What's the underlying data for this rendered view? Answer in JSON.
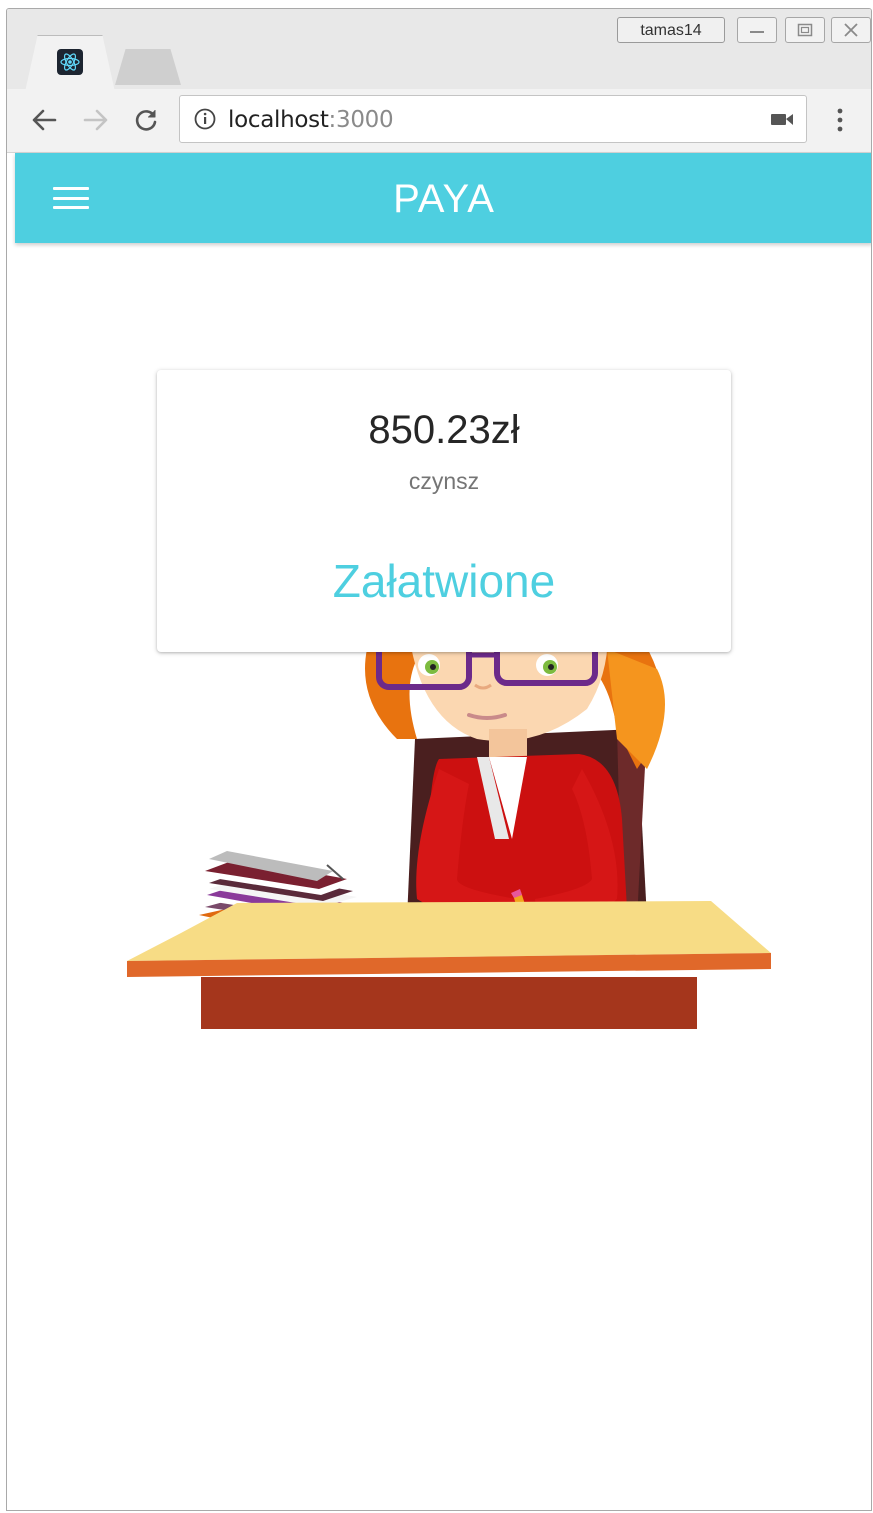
{
  "browser": {
    "user_badge": "tamas14",
    "address": {
      "host": "localhost",
      "port": ":3000"
    },
    "icons": {
      "favicon": "react-icon",
      "back": "back-arrow-icon",
      "forward": "forward-arrow-icon",
      "reload": "reload-icon",
      "info": "info-icon",
      "camera": "camera-icon",
      "menu": "more-vert-icon"
    }
  },
  "app": {
    "title": "PAYA",
    "accent_color": "#4ecfe0",
    "menu_icon": "hamburger-menu-icon"
  },
  "card": {
    "amount": "850.23zł",
    "label": "czynsz",
    "status": "Załatwione"
  },
  "illustration": "woman-writing-at-desk"
}
